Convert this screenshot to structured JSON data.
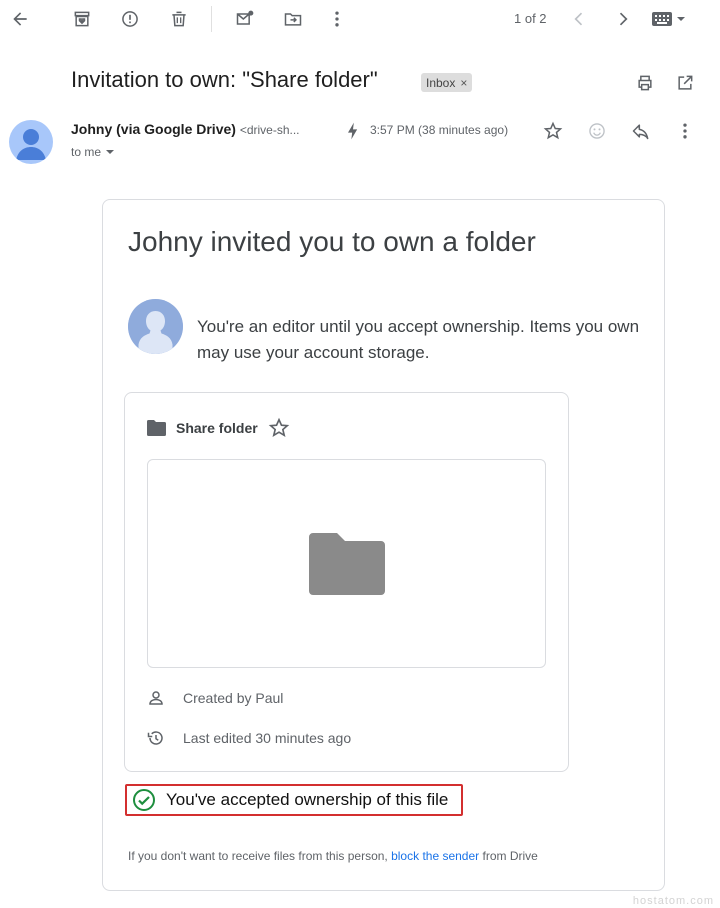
{
  "toolbar": {
    "pager_text": "1 of 2",
    "icons": [
      "back-arrow-icon",
      "archive-icon",
      "report-spam-icon",
      "delete-icon",
      "mark-unread-icon",
      "move-to-icon",
      "more-vert-icon",
      "prev-icon",
      "next-icon",
      "keyboard-icon"
    ]
  },
  "email": {
    "subject": "Invitation to own: \"Share folder\"",
    "label_badge": "Inbox",
    "label_close": "×",
    "sender_name": "Johny (via Google Drive)",
    "sender_address": "<drive-sh...",
    "time": "3:57 PM (38 minutes ago)",
    "recipient": "to me"
  },
  "body": {
    "title": "Johny invited you to own a folder",
    "editor_message": "You're an editor until you accept ownership. Items you own may use your account storage.",
    "folder_name": "Share folder",
    "created_by": "Created by Paul",
    "last_edited": "Last edited 30 minutes ago",
    "accepted_message": "You've accepted ownership of this file",
    "footer_prefix": "If you don't want to receive files from this person,",
    "footer_link": "block the sender",
    "footer_suffix": "from Drive"
  },
  "watermark": "hostatom.com",
  "colors": {
    "accent_link": "#1a73e8",
    "success_green": "#1e8e3e",
    "highlight_red": "#d32f2f",
    "avatar_blue": "#a8c7fa"
  }
}
